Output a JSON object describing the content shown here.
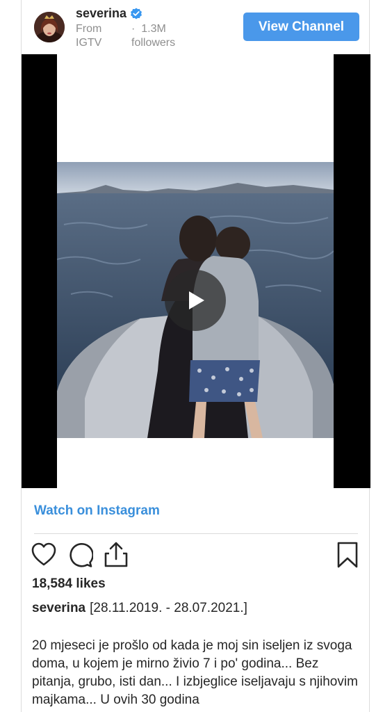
{
  "header": {
    "username": "severina",
    "verified": true,
    "from_label": "From",
    "source": "IGTV",
    "separator": "·",
    "followers_count": "1.3M",
    "followers_label": "followers",
    "view_channel_label": "View Channel"
  },
  "video": {
    "play_icon": "play-icon"
  },
  "watch_link": "Watch on Instagram",
  "actions": {
    "like_icon": "heart-icon",
    "comment_icon": "comment-icon",
    "share_icon": "share-icon",
    "save_icon": "bookmark-icon"
  },
  "likes": "18,584 likes",
  "caption": {
    "username": "severina",
    "date_range": "[28.11.2019. - 28.07.2021.]",
    "text": "20 mjeseci je prošlo od kada je moj sin iseljen iz svoga doma, u kojem je mirno živio 7 i po' godina... Bez pitanja, grubo, isti dan... I izbjeglice iseljavaju s njihovim majkama... U ovih 30 godina"
  },
  "colors": {
    "accent": "#4a98ea",
    "link": "#3a8fdb",
    "verified": "#3897f0"
  }
}
